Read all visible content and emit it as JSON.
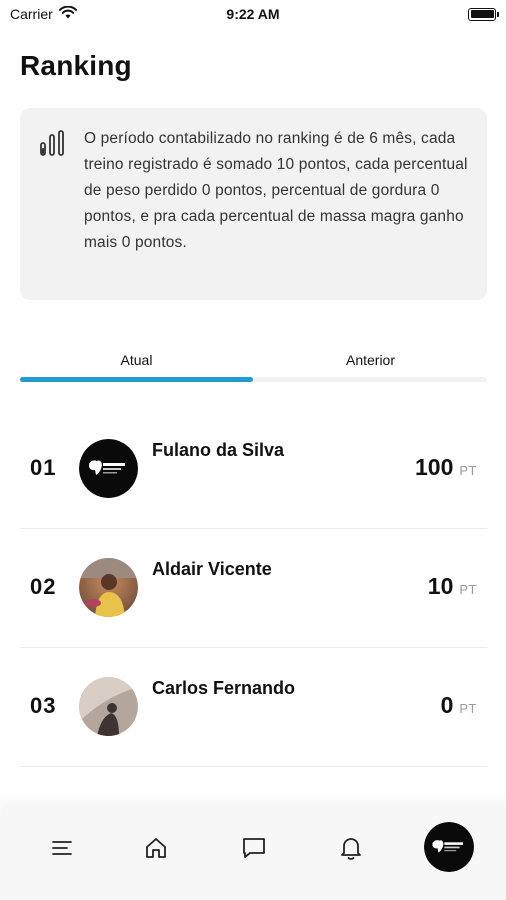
{
  "status_bar": {
    "carrier": "Carrier",
    "time": "9:22 AM",
    "battery_level": 1.0
  },
  "header": {
    "title": "Ranking"
  },
  "info_card": {
    "icon": "bar-chart-icon",
    "text": "O período contabilizado no ranking é de 6 mês, cada treino registrado é somado 10 pontos, cada percentual de peso perdido 0 pontos, percentual de gordura 0 pontos, e pra cada percentual de massa magra ganho mais 0 pontos."
  },
  "tabs": {
    "items": [
      {
        "label": "Atual",
        "active": true
      },
      {
        "label": "Anterior",
        "active": false
      }
    ],
    "accent": "#1e9bd7"
  },
  "ranking": {
    "unit": "PT",
    "rows": [
      {
        "position": "01",
        "name": "Fulano da Silva",
        "score": "100",
        "avatar": "logo-avatar"
      },
      {
        "position": "02",
        "name": "Aldair Vicente",
        "score": "10",
        "avatar": "photo-avatar"
      },
      {
        "position": "03",
        "name": "Carlos Fernando",
        "score": "0",
        "avatar": "photo-avatar"
      }
    ]
  },
  "bottom_nav": {
    "items": [
      "menu-icon",
      "home-icon",
      "chat-icon",
      "bell-icon",
      "profile-avatar"
    ]
  }
}
